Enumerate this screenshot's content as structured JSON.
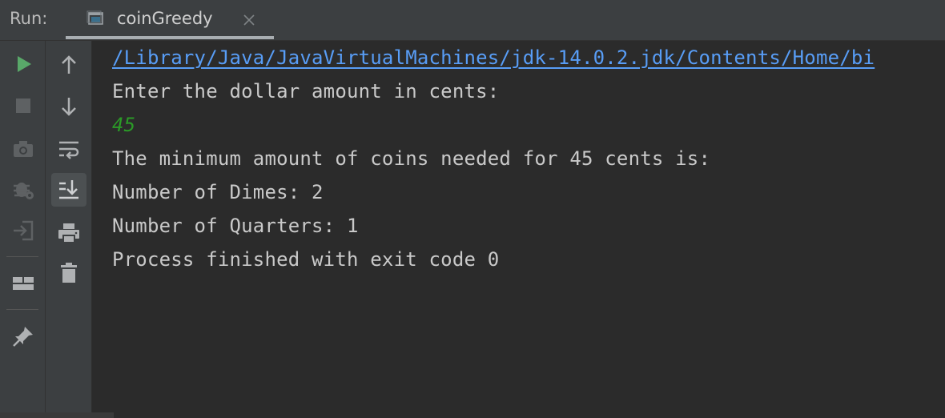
{
  "header": {
    "run_label": "Run:",
    "tab_title": "coinGreedy",
    "tab_icon": "window-icon",
    "close_icon": "close-icon"
  },
  "toolbar_primary": [
    {
      "name": "rerun-icon",
      "color": "#59a869"
    },
    {
      "name": "stop-icon",
      "color": "#5e6163"
    },
    {
      "name": "camera-icon",
      "color": "#5e6163"
    },
    {
      "name": "settings-bug-icon",
      "color": "#5e6163"
    },
    {
      "name": "login-icon",
      "color": "#5e6163"
    },
    {
      "name": "layout-icon",
      "color": "#afb1b3"
    },
    {
      "name": "pin-icon",
      "color": "#afb1b3"
    }
  ],
  "toolbar_secondary": [
    {
      "name": "arrow-up-icon"
    },
    {
      "name": "arrow-down-icon"
    },
    {
      "name": "soft-wrap-icon"
    },
    {
      "name": "scroll-to-end-icon"
    },
    {
      "name": "print-icon"
    },
    {
      "name": "trash-icon"
    }
  ],
  "console": {
    "path_line": "/Library/Java/JavaVirtualMachines/jdk-14.0.2.jdk/Contents/Home/bi",
    "prompt": "Enter the dollar amount in cents:",
    "user_input": "45",
    "result_header": "The minimum amount of coins needed for 45 cents is:",
    "dimes_line": "Number of Dimes: 2",
    "quarters_line": "Number of Quarters: 1",
    "exit_line": "Process finished with exit code 0"
  },
  "colors": {
    "panel_bg": "#3c3f41",
    "console_bg": "#2b2b2b",
    "link": "#589df6",
    "input_text": "#2b9a27",
    "output_text": "#c9c9c9",
    "run_green": "#59a869"
  }
}
